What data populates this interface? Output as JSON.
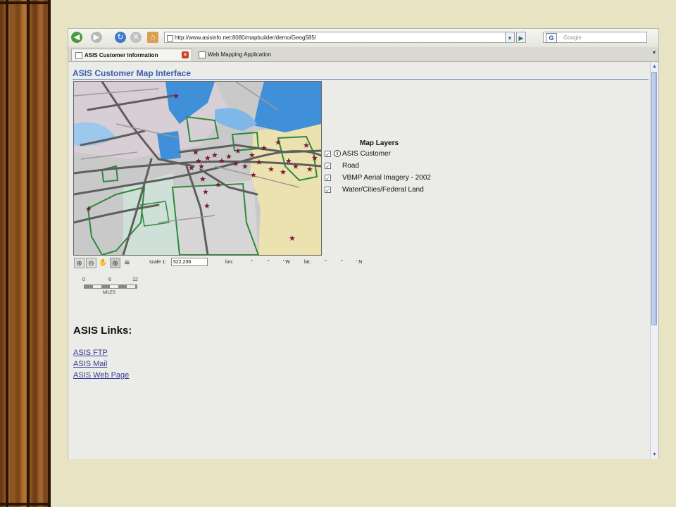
{
  "colors": {
    "title_blue": "#3a5fb0",
    "link": "#3a3a9a",
    "marker": "#7a1838",
    "slide_bg": "#e8e4c3"
  },
  "browser": {
    "url": "http://www.asisinfo.net:8080/mapbuilder/demo/Geog585/",
    "search_placeholder": "Google",
    "tabs": [
      {
        "label": "ASIS Customer Information",
        "active": true
      },
      {
        "label": "Web Mapping Application",
        "active": false
      }
    ],
    "icons": [
      "back-icon",
      "forward-icon",
      "reload-icon",
      "stop-icon",
      "home-icon"
    ]
  },
  "page": {
    "title": "ASIS Customer Map Interface"
  },
  "map_toolbar": {
    "tools": [
      "zoom-in-icon",
      "zoom-out-icon",
      "pan-icon",
      "zoom-box-icon",
      "identify-icon"
    ],
    "scale_label": "scale 1:",
    "scale_value": "522,236",
    "lon_label": "lon:",
    "lat_label": "lat:",
    "deg": "°",
    "min": "'",
    "sec": "\"",
    "west": "' W",
    "north": "' N"
  },
  "scalebar": {
    "ticks": [
      "0",
      "6",
      "12"
    ],
    "unit": "MILES"
  },
  "legend": {
    "title": "Map Layers",
    "layers": [
      {
        "label": "ASIS Customer",
        "checked": true,
        "info": true
      },
      {
        "label": "Road",
        "checked": true,
        "info": false
      },
      {
        "label": "VBMP Aerial Imagery - 2002",
        "checked": true,
        "info": false
      },
      {
        "label": "Water/Cities/Federal Land",
        "checked": true,
        "info": false
      }
    ]
  },
  "links": {
    "heading": "ASIS Links:",
    "items": [
      "ASIS FTP",
      "ASIS Mail",
      "ASIS Web Page"
    ]
  }
}
